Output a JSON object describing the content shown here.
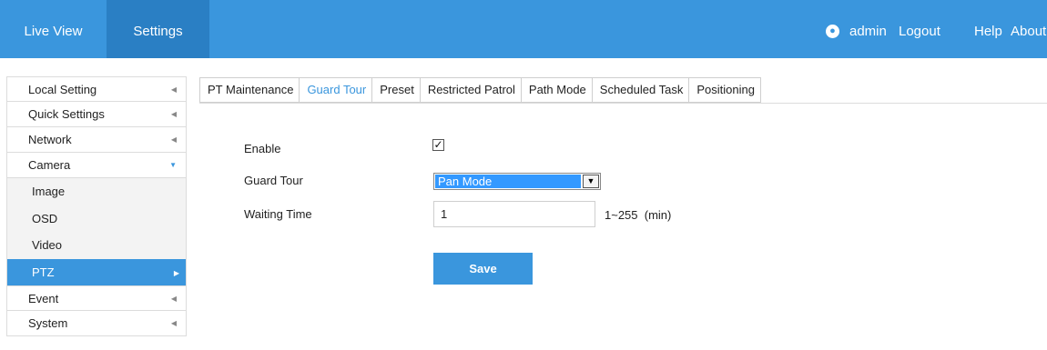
{
  "topbar": {
    "live_view": "Live View",
    "settings": "Settings",
    "user_icon": "user-icon",
    "user": "admin",
    "logout": "Logout",
    "help": "Help",
    "about": "About"
  },
  "sidebar": {
    "items": [
      {
        "label": "Local Setting",
        "expanded": false
      },
      {
        "label": "Quick Settings",
        "expanded": false
      },
      {
        "label": "Network",
        "expanded": false
      },
      {
        "label": "Camera",
        "expanded": true
      }
    ],
    "sub_items": [
      {
        "label": "Image",
        "active": false
      },
      {
        "label": "OSD",
        "active": false
      },
      {
        "label": "Video",
        "active": false
      },
      {
        "label": "PTZ",
        "active": true
      }
    ],
    "after_items": [
      {
        "label": "Event",
        "expanded": false
      },
      {
        "label": "System",
        "expanded": false
      }
    ]
  },
  "tabs": [
    "PT Maintenance",
    "Guard Tour",
    "Preset",
    "Restricted Patrol",
    "Path Mode",
    "Scheduled Task",
    "Positioning"
  ],
  "active_tab": "Guard Tour",
  "form": {
    "enable_label": "Enable",
    "enable_checked": true,
    "guard_tour_label": "Guard Tour",
    "guard_tour_value": "Pan Mode",
    "waiting_time_label": "Waiting Time",
    "waiting_time_value": "1",
    "waiting_time_range": "1~255  (min)"
  },
  "save_label": "Save",
  "colors": {
    "accent": "#3a96dd",
    "accent_dark": "#2a7fc4",
    "select_highlight": "#3399ff"
  }
}
